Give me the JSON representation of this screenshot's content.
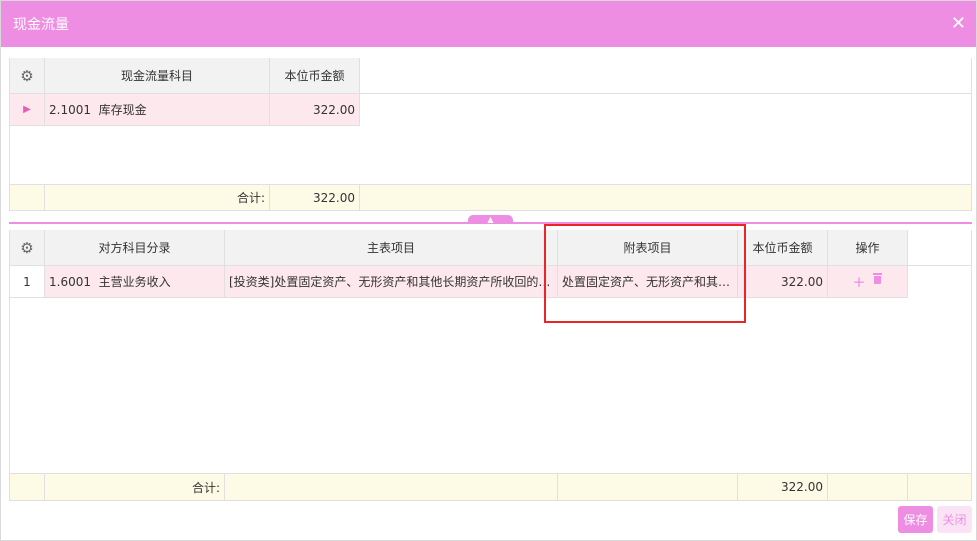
{
  "dialog": {
    "title": "现金流量",
    "close_glyph": "✕"
  },
  "top_table": {
    "headers": [
      "现金流量科目",
      "本位币金额"
    ],
    "rows": [
      {
        "code": "2.1001",
        "name": "库存现金",
        "amount": "322.00"
      }
    ],
    "footer": {
      "label": "合计:",
      "amount": "322.00"
    }
  },
  "bottom_table": {
    "headers": [
      "对方科目分录",
      "主表项目",
      "附表项目",
      "本位币金额",
      "操作"
    ],
    "rows": [
      {
        "index": "1",
        "code": "1.6001",
        "name": "主营业务收入",
        "main_item": "[投资类]处置固定资产、无形资产和其他长期资产所收回的现金净额",
        "sub_item": "处置固定资产、无形资产和其他长期资产的损失",
        "amount": "322.00",
        "add_glyph": "+"
      }
    ],
    "footer": {
      "label": "合计:",
      "amount": "322.00"
    }
  },
  "buttons": {
    "save": "保存",
    "close": "关闭"
  },
  "icons": {
    "settings": "gear-icon",
    "row_pointer": "triangle-right-icon",
    "add": "plus-icon",
    "delete": "trash-icon",
    "collapse": "chevron-up-icon"
  },
  "colors": {
    "accent": "#ee8ee2",
    "row_selected": "#fde8ee",
    "footer": "#fdfbe6",
    "highlight": "#e8262a"
  }
}
